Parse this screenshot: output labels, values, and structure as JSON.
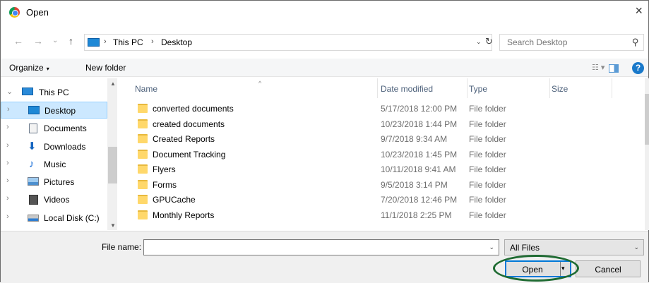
{
  "window": {
    "title": "Open",
    "close_glyph": "×"
  },
  "address": {
    "back_glyph": "←",
    "forward_glyph": "→",
    "recent_glyph": "⌄",
    "up_glyph": "↑",
    "sep_glyph": "›",
    "crumbs": [
      "This PC",
      "Desktop"
    ],
    "dropdown_glyph": "⌄",
    "refresh_glyph": "↻"
  },
  "search": {
    "placeholder": "Search Desktop",
    "icon_glyph": "⚲"
  },
  "toolbar": {
    "organize_label": "Organize",
    "caret": "▾",
    "new_folder_label": "New folder",
    "view_glyph": "☷ ▾",
    "help_glyph": "?"
  },
  "nav": {
    "chevron_closed": "›",
    "chevron_open": "⌄",
    "items": [
      {
        "label": "This PC",
        "icon": "computer-icon"
      },
      {
        "label": "Desktop",
        "icon": "desktop-icon"
      },
      {
        "label": "Documents",
        "icon": "documents-icon"
      },
      {
        "label": "Downloads",
        "icon": "downloads-icon"
      },
      {
        "label": "Music",
        "icon": "music-icon"
      },
      {
        "label": "Pictures",
        "icon": "pictures-icon"
      },
      {
        "label": "Videos",
        "icon": "videos-icon"
      },
      {
        "label": "Local Disk (C:)",
        "icon": "local-disk-icon"
      }
    ]
  },
  "columns": {
    "name": "Name",
    "date": "Date modified",
    "type": "Type",
    "size": "Size",
    "sort_glyph": "^"
  },
  "files": [
    {
      "name": "converted documents",
      "date": "5/17/2018 12:00 PM",
      "type": "File folder"
    },
    {
      "name": "created documents",
      "date": "10/23/2018 1:44 PM",
      "type": "File folder"
    },
    {
      "name": "Created Reports",
      "date": "9/7/2018 9:34 AM",
      "type": "File folder"
    },
    {
      "name": "Document Tracking",
      "date": "10/23/2018 1:45 PM",
      "type": "File folder"
    },
    {
      "name": "Flyers",
      "date": "10/11/2018 9:41 AM",
      "type": "File folder"
    },
    {
      "name": "Forms",
      "date": "9/5/2018 3:14 PM",
      "type": "File folder"
    },
    {
      "name": "GPUCache",
      "date": "7/20/2018 12:46 PM",
      "type": "File folder"
    },
    {
      "name": "Monthly Reports",
      "date": "11/1/2018 2:25 PM",
      "type": "File folder"
    }
  ],
  "bottom": {
    "file_name_label": "File name:",
    "file_name_value": "",
    "file_type_selected": "All Files",
    "caret": "⌄",
    "open_label": "Open",
    "open_caret": "▾",
    "cancel_label": "Cancel"
  },
  "colors": {
    "accent": "#0078d7",
    "selection": "#cce8ff",
    "highlight_ring": "#1f6b32"
  }
}
